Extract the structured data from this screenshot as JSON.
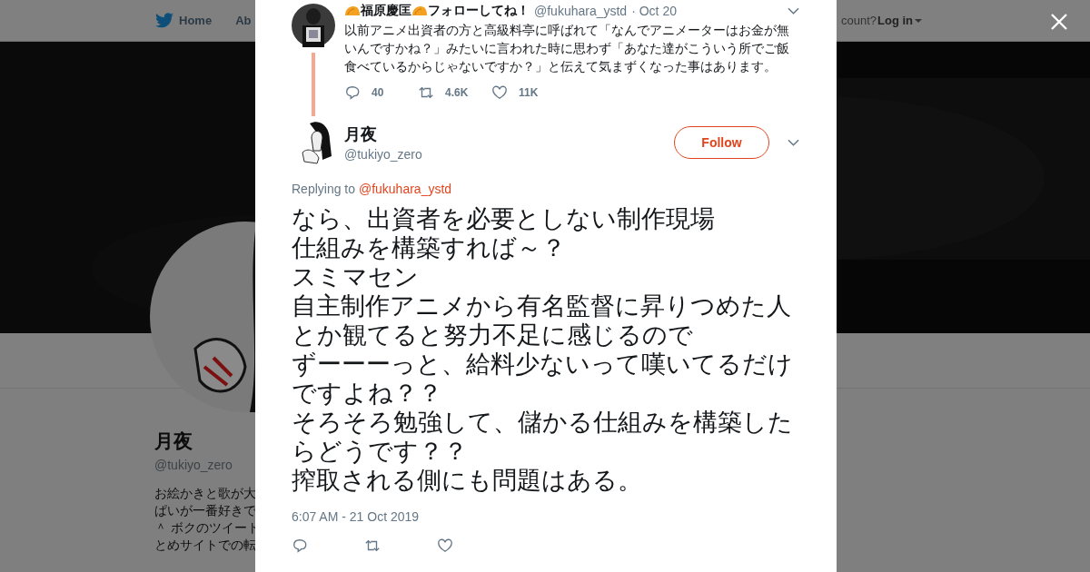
{
  "background_page": {
    "nav": [
      {
        "label": "Home"
      },
      {
        "label": "Ab"
      }
    ],
    "login_prompt": "count?",
    "login": "Log in",
    "profile": {
      "name": "月夜",
      "handle": "@tukiyo_zero",
      "bio_lines": [
        "お絵かきと歌が大",
        "ぱいが一番好きで",
        "＾ ボクのツイート",
        "とめサイトでの転"
      ]
    }
  },
  "modal": {
    "parent_tweet": {
      "name": "福原慶匡",
      "name_suffix": "フォローしてね！",
      "handle": "@fukuhara_ystd",
      "date": "· Oct 20",
      "text": "以前アニメ出資者の方と高級料亭に呼ばれて「なんでアニメーターはお金が無いんですかね？」みたいに言われた時に思わず「あなた達がこういう所でご飯食べているからじゃないですか？」と伝えて気まずくなった事はあります。",
      "replies": "40",
      "retweets": "4.6K",
      "likes": "11K"
    },
    "tweet": {
      "name": "月夜",
      "handle": "@tukiyo_zero",
      "follow_label": "Follow",
      "replying_to_label": "Replying to",
      "replying_to": "@fukuhara_ystd",
      "text_lines": [
        "なら、出資者を必要としない制作現場",
        "仕組みを構築すれば～？",
        "スミマセン",
        "自主制作アニメから有名監督に昇りつめた人とか観てると努力不足に感じるので",
        "ずーーーっと、給料少ないって嘆いてるだけですよね？？",
        "そろそろ勉強して、儲かる仕組みを構築したらどうです？？",
        "搾取される側にも問題はある。"
      ],
      "timestamp": "6:07 AM - 21 Oct 2019"
    }
  }
}
